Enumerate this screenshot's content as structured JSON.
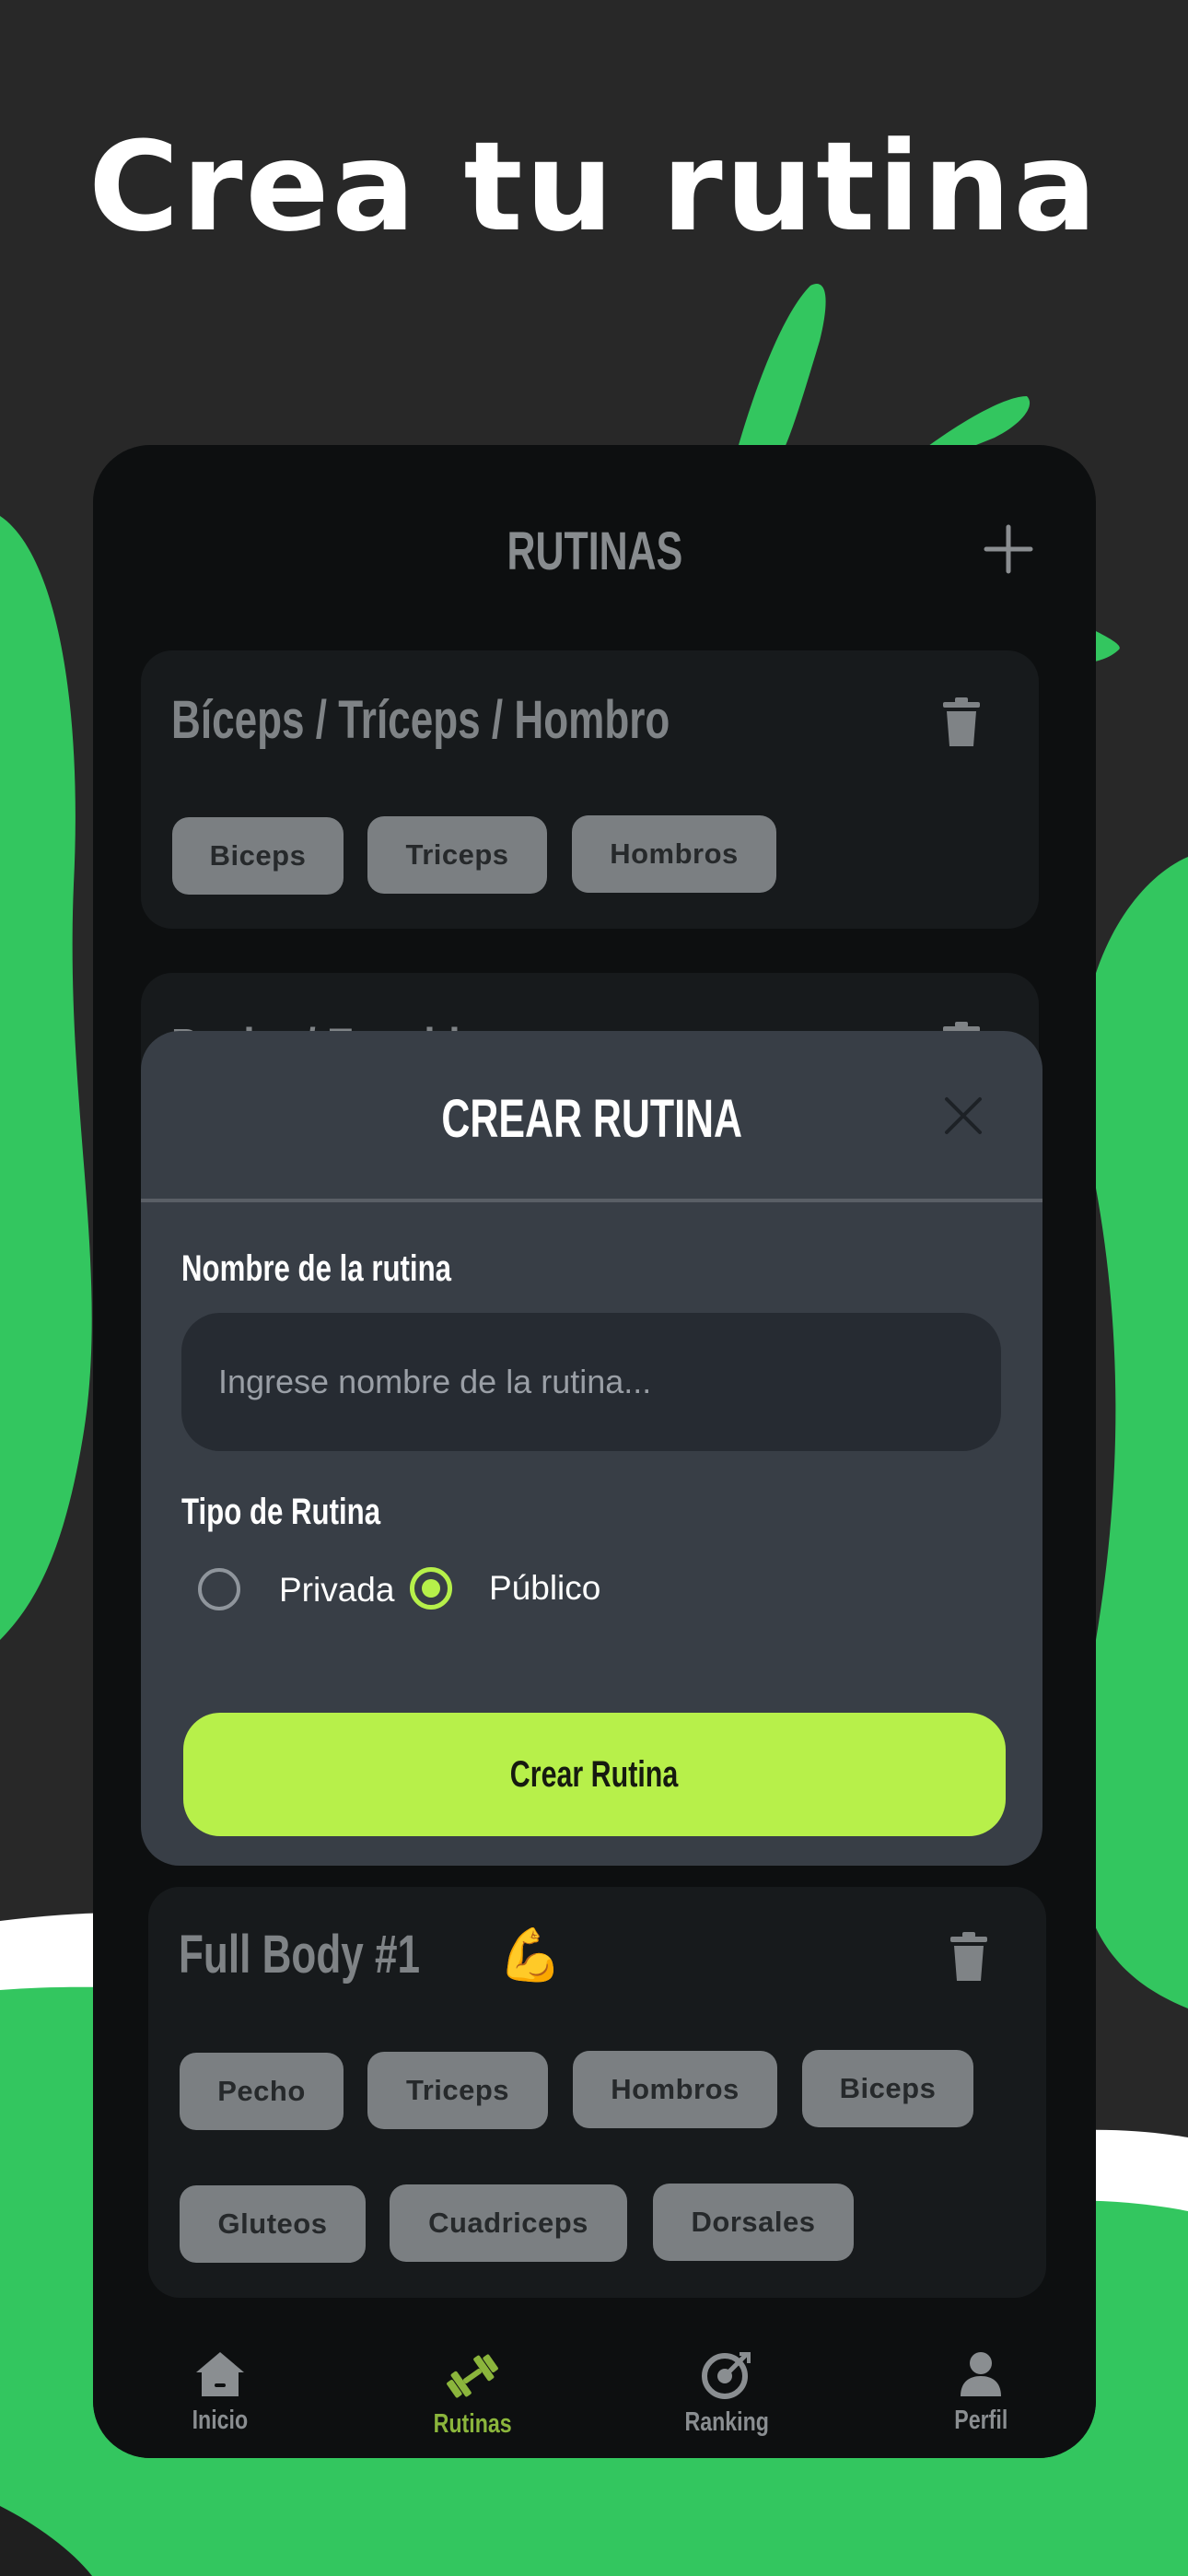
{
  "headline": "Crea tu rutina",
  "colors": {
    "background": "#282828",
    "brand_green": "#33c65f",
    "accent_lime": "#b7f04a",
    "modal_bg": "#383e46",
    "card_bg": "#171a1c"
  },
  "header": {
    "title": "RUTINAS",
    "add_icon": "plus-icon"
  },
  "routines": [
    {
      "title": "Bíceps / Tríceps / Hombro",
      "chips": [
        "Biceps",
        "Triceps",
        "Hombros"
      ]
    },
    {
      "title": "Pecho / Espalda",
      "chips": []
    },
    {
      "title": "Full Body #1",
      "emoji": "💪",
      "chips": [
        "Pecho",
        "Triceps",
        "Hombros",
        "Biceps",
        "Gluteos",
        "Cuadriceps",
        "Dorsales"
      ]
    }
  ],
  "modal": {
    "title": "CREAR RUTINA",
    "name_label": "Nombre de la rutina",
    "name_placeholder": "Ingrese nombre de la rutina...",
    "name_value": "",
    "type_label": "Tipo de Rutina",
    "type_options": [
      "Privada",
      "Público"
    ],
    "type_selected": "Público",
    "submit_label": "Crear Rutina"
  },
  "tabbar": {
    "tabs": [
      {
        "label": "Inicio",
        "icon": "home-icon",
        "active": false
      },
      {
        "label": "Rutinas",
        "icon": "dumbbell-icon",
        "active": true
      },
      {
        "label": "Ranking",
        "icon": "target-icon",
        "active": false
      },
      {
        "label": "Perfil",
        "icon": "user-icon",
        "active": false
      }
    ]
  }
}
